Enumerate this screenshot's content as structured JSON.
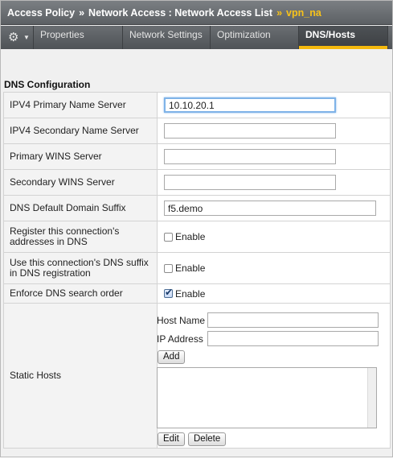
{
  "breadcrumb": {
    "items": [
      "Access Policy",
      "Network Access : Network Access List",
      "vpn_na"
    ],
    "separator": "»"
  },
  "tabs": {
    "gear_icon": "gear-icon",
    "items": [
      {
        "label": "Properties",
        "active": false
      },
      {
        "label": "Network Settings",
        "active": false
      },
      {
        "label": "Optimization",
        "active": false
      },
      {
        "label": "DNS/Hosts",
        "active": true
      }
    ]
  },
  "section": {
    "title": "DNS Configuration"
  },
  "form": {
    "ipv4_primary": {
      "label": "IPV4 Primary Name Server",
      "value": "10.10.20.1"
    },
    "ipv4_secondary": {
      "label": "IPV4 Secondary Name Server",
      "value": ""
    },
    "primary_wins": {
      "label": "Primary WINS Server",
      "value": ""
    },
    "secondary_wins": {
      "label": "Secondary WINS Server",
      "value": ""
    },
    "dns_suffix": {
      "label": "DNS Default Domain Suffix",
      "value": "f5.demo"
    },
    "register": {
      "label_line1": "Register this connection's",
      "label_line2": "addresses in DNS",
      "option": "Enable",
      "checked": false
    },
    "use_suffix": {
      "label_line1": "Use this connection's DNS suffix",
      "label_line2": "in DNS registration",
      "option": "Enable",
      "checked": false
    },
    "enforce_order": {
      "label": "Enforce DNS search order",
      "option": "Enable",
      "checked": true
    },
    "static_hosts": {
      "label": "Static Hosts",
      "host_name_label": "Host Name",
      "host_name_value": "",
      "ip_label": "IP Address",
      "ip_value": "",
      "add_label": "Add",
      "edit_label": "Edit",
      "delete_label": "Delete"
    }
  },
  "colors": {
    "accent": "#f5b90d",
    "breadcrumb_current": "#f7c21a",
    "header_bg": "#5c6064"
  }
}
